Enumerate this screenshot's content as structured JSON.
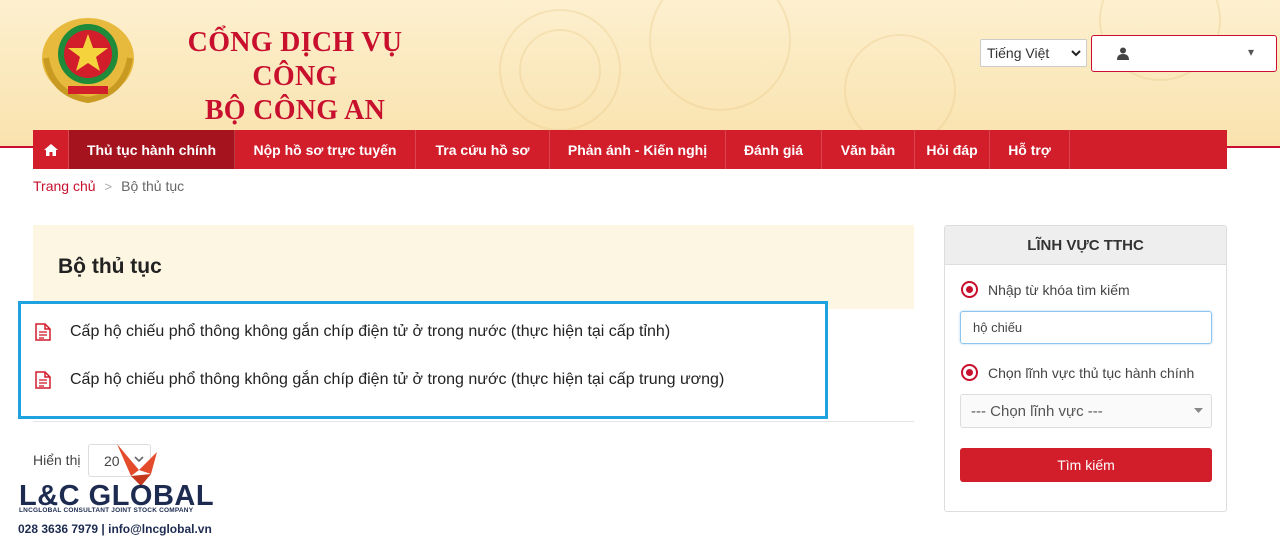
{
  "header": {
    "title_line1": "CỔNG DỊCH VỤ CÔNG",
    "title_line2": "BỘ CÔNG AN",
    "language": "Tiếng Việt",
    "user_caret": "▾"
  },
  "nav": {
    "items": [
      {
        "label": "Thủ tục hành chính",
        "active": true
      },
      {
        "label": "Nộp hồ sơ trực tuyến"
      },
      {
        "label": "Tra cứu hồ sơ"
      },
      {
        "label": "Phản ánh - Kiến nghị"
      },
      {
        "label": "Đánh giá"
      },
      {
        "label": "Văn bản"
      },
      {
        "label": "Hỏi đáp"
      },
      {
        "label": "Hỗ trợ"
      }
    ]
  },
  "breadcrumb": {
    "home": "Trang chủ",
    "separator": ">",
    "current": "Bộ thủ tục"
  },
  "main": {
    "title": "Bộ thủ tục",
    "results": [
      "Cấp hộ chiếu phổ thông không gắn chíp điện tử ở trong nước (thực hiện tại cấp tỉnh)",
      "Cấp hộ chiếu phổ thông không gắn chíp điện tử ở trong nước (thực hiện tại cấp trung ương)"
    ],
    "pager_label": "Hiển thị",
    "pager_value": "20"
  },
  "sidebar": {
    "title": "LĨNH VỰC TTHC",
    "option_keyword": "Nhập từ khóa tìm kiếm",
    "search_value": "hộ chiếu",
    "option_field": "Chọn lĩnh vực thủ tục hành chính",
    "field_placeholder": "--- Chọn lĩnh vực ---",
    "search_button": "Tìm kiếm"
  },
  "watermark": {
    "brand": "L&C GLOBAL",
    "company": "LNCGLOBAL CONSULTANT JOINT STOCK COMPANY",
    "contact": "028 3636 7979 | info@lncglobal.vn"
  },
  "colors": {
    "brand_red": "#d21d2b",
    "active_nav": "#a4131e",
    "header_bg": "#fdf0cf",
    "highlight_border": "#1ea3e0"
  },
  "icons": [
    "emblem-icon",
    "home-icon",
    "user-icon",
    "document-icon",
    "chevron-down-icon"
  ]
}
